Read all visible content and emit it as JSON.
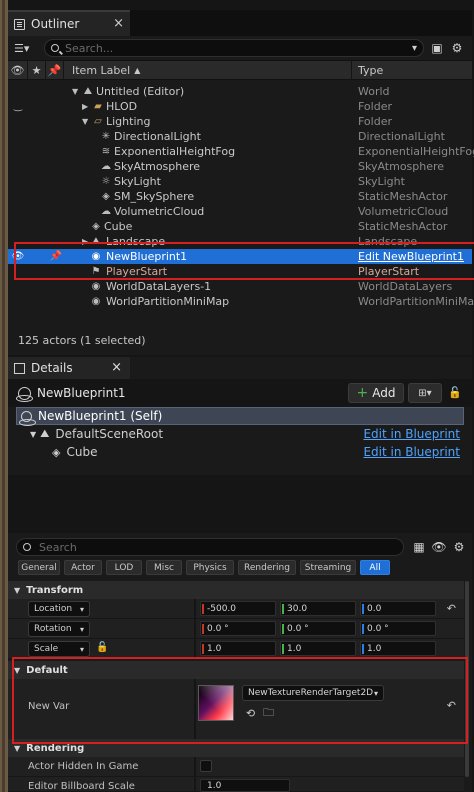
{
  "outliner": {
    "tab_label": "Outliner",
    "search_placeholder": "Search...",
    "columns": {
      "item_label": "Item Label",
      "sort_arrow": "▲",
      "type": "Type"
    },
    "rows": [
      {
        "label": "Untitled (Editor)",
        "type": "World",
        "icon": "world-icon"
      },
      {
        "label": "HLOD",
        "type": "Folder",
        "icon": "folder-icon"
      },
      {
        "label": "Lighting",
        "type": "Folder",
        "icon": "folder-open-icon"
      },
      {
        "label": "DirectionalLight",
        "type": "DirectionalLight",
        "icon": "directional-light-icon"
      },
      {
        "label": "ExponentialHeightFog",
        "type": "ExponentialHeightFog",
        "icon": "fog-icon"
      },
      {
        "label": "SkyAtmosphere",
        "type": "SkyAtmosphere",
        "icon": "sky-atmosphere-icon"
      },
      {
        "label": "SkyLight",
        "type": "SkyLight",
        "icon": "skylight-icon"
      },
      {
        "label": "SM_SkySphere",
        "type": "StaticMeshActor",
        "icon": "static-mesh-icon"
      },
      {
        "label": "VolumetricCloud",
        "type": "VolumetricCloud",
        "icon": "cloud-icon"
      },
      {
        "label": "Cube",
        "type": "StaticMeshActor",
        "icon": "static-mesh-icon"
      },
      {
        "label": "Landscape",
        "type": "Landscape",
        "icon": "landscape-icon"
      },
      {
        "label": "NewBlueprint1",
        "type": "Edit NewBlueprint1",
        "icon": "blueprint-icon"
      },
      {
        "label": "PlayerStart",
        "type": "PlayerStart",
        "icon": "player-start-icon"
      },
      {
        "label": "WorldDataLayers-1",
        "type": "WorldDataLayers",
        "icon": "blueprint-icon"
      },
      {
        "label": "WorldPartitionMiniMap",
        "type": "WorldPartitionMiniMap",
        "icon": "blueprint-icon"
      }
    ],
    "status": "125 actors (1 selected)"
  },
  "details": {
    "tab_label": "Details",
    "object_name": "NewBlueprint1",
    "add_label": "Add",
    "components": [
      {
        "label": "NewBlueprint1 (Self)",
        "edit": ""
      },
      {
        "label": "DefaultSceneRoot",
        "edit": "Edit in Blueprint"
      },
      {
        "label": "Cube",
        "edit": "Edit in Blueprint"
      }
    ],
    "search_placeholder": "Search",
    "categories": [
      "General",
      "Actor",
      "LOD",
      "Misc",
      "Physics",
      "Rendering",
      "Streaming",
      "All"
    ],
    "sections": {
      "transform": "Transform",
      "default": "Default",
      "rendering": "Rendering"
    },
    "transform": {
      "location": {
        "label": "Location",
        "x": "-500.0",
        "y": "30.0",
        "z": "0.0"
      },
      "rotation": {
        "label": "Rotation",
        "x": "0.0 °",
        "y": "0.0 °",
        "z": "0.0 °"
      },
      "scale": {
        "label": "Scale",
        "x": "1.0",
        "y": "1.0",
        "z": "1.0"
      }
    },
    "new_var": {
      "label": "New Var",
      "asset": "NewTextureRenderTarget2D"
    },
    "rendering": {
      "actor_hidden_label": "Actor Hidden In Game",
      "billboard_label": "Editor Billboard Scale",
      "billboard_value": "1.0"
    }
  },
  "colors": {
    "selection": "#1f6fd6",
    "highlight_box": "#d42020",
    "link": "#4ea3ff",
    "axis_x": "#c0392b",
    "axis_y": "#4caf50",
    "axis_z": "#2f7ee6"
  }
}
